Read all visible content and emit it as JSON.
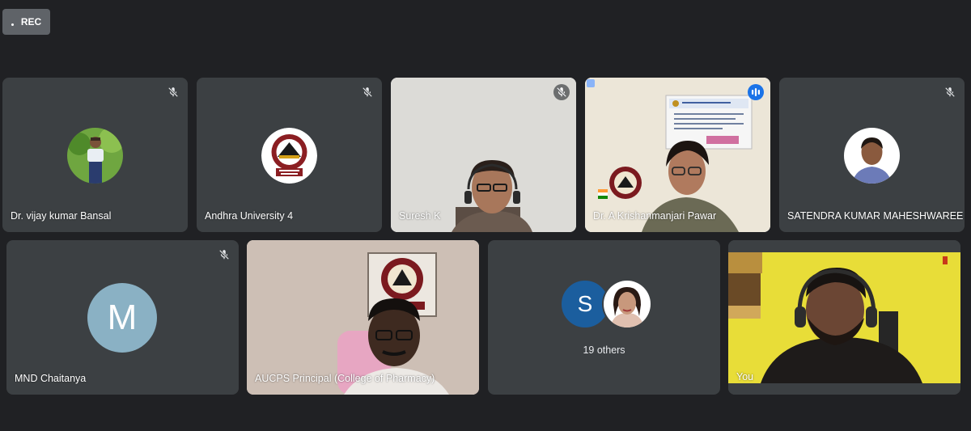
{
  "recording": {
    "label": "REC"
  },
  "participants": [
    {
      "name": "Dr. vijay kumar Bansal",
      "muted": true,
      "avatar": "photo-avatar"
    },
    {
      "name": "Andhra University 4",
      "muted": true,
      "avatar": "university-logo-avatar"
    },
    {
      "name": "Suresh K",
      "muted": true,
      "video": true
    },
    {
      "name": "Dr. A Krishanmanjari Pawar",
      "muted": false,
      "speaking": true,
      "video": true
    },
    {
      "name": "SATENDRA KUMAR MAHESHWAREE",
      "muted": true,
      "avatar": "photo-avatar"
    },
    {
      "name": "MND Chaitanya",
      "muted": true,
      "avatar_letter": "M"
    },
    {
      "name": "AUCPS Principal (College of Pharmacy)",
      "muted": false,
      "video": true
    },
    {
      "name": "You",
      "muted": false,
      "video": true
    }
  ],
  "others": {
    "avatar_letter": "S",
    "label": "19 others"
  },
  "colors": {
    "background": "#202124",
    "tile": "#3c4043",
    "speaking_accent": "#1a73e8",
    "avatar_m": "#8ab1c4",
    "avatar_s": "#1b5e9e"
  }
}
